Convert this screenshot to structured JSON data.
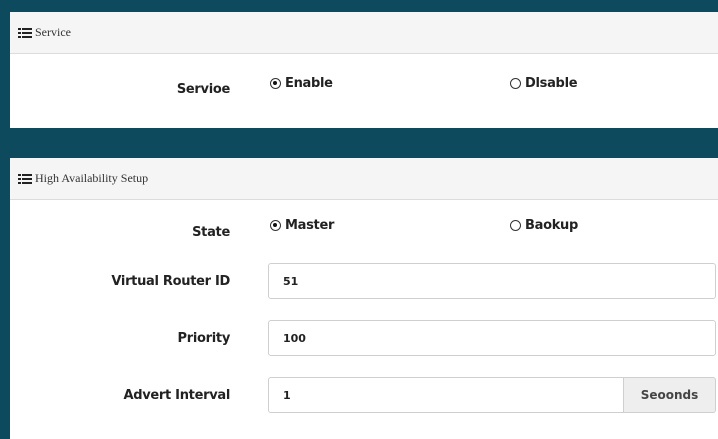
{
  "service_section": {
    "title": "Service",
    "service_label": "Servioe",
    "options": [
      {
        "label": "Enable",
        "selected": true
      },
      {
        "label": "Dlsable",
        "selected": false
      }
    ]
  },
  "ha_section": {
    "title": "High Availability Setup",
    "state_label": "State",
    "state_options": [
      {
        "label": "Master",
        "selected": true
      },
      {
        "label": "Baokup",
        "selected": false
      }
    ],
    "vrid_label": "Virtual Router ID",
    "vrid_value": "51",
    "priority_label": "Priority",
    "priority_value": "100",
    "advert_label": "Advert Interval",
    "advert_value": "1",
    "advert_unit": "Seoonds"
  },
  "colors": {
    "divider_band": "#0d4a5e",
    "header_bg": "#f5f5f5"
  }
}
